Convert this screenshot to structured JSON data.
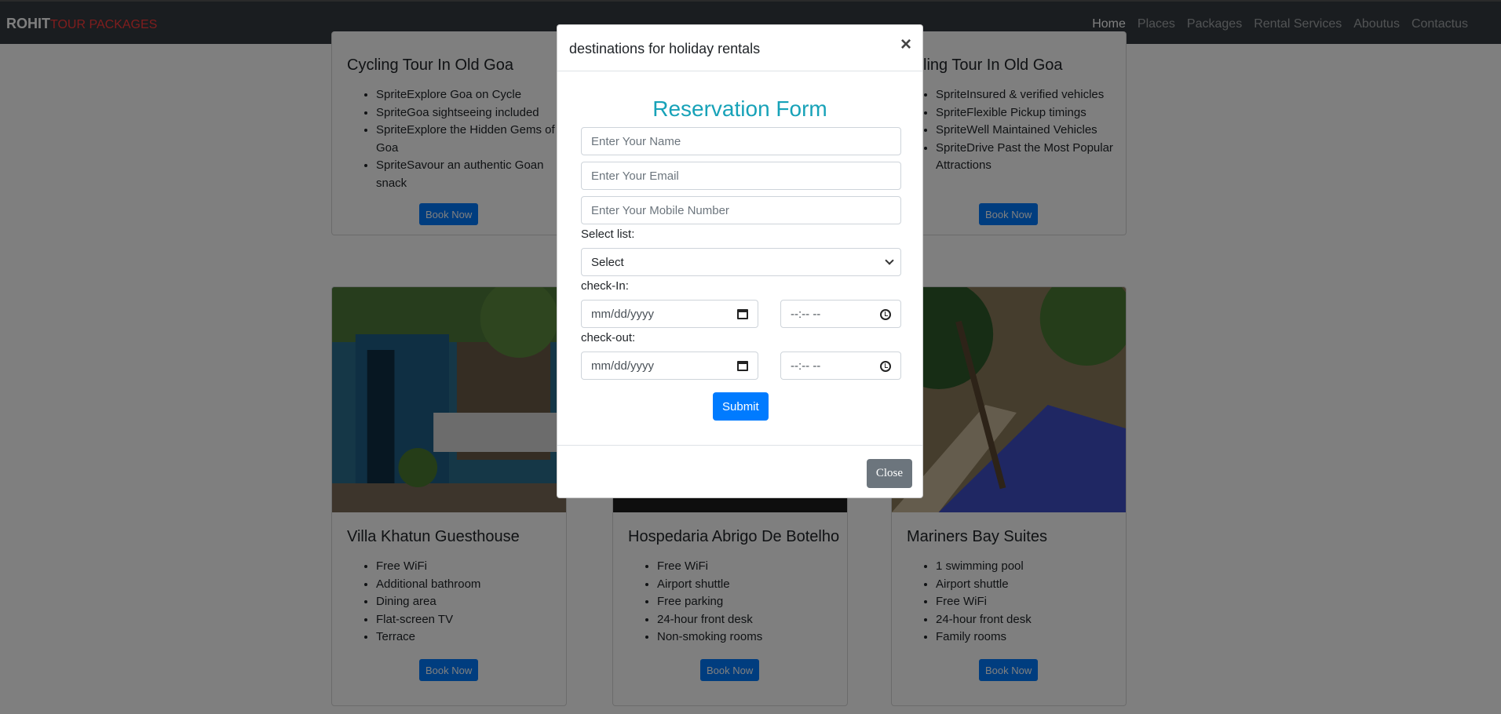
{
  "navbar": {
    "brand_main": "ROHIT",
    "brand_sub": "TOUR PACKAGES",
    "links": [
      "Home",
      "Places",
      "Packages",
      "Rental Services",
      "Aboutus",
      "Contactus"
    ]
  },
  "top_cards": [
    {
      "title": "Cycling Tour In Old Goa",
      "features": [
        "SpriteExplore Goa on Cycle",
        "SpriteGoa sightseeing included",
        "SpriteExplore the Hidden Gems of Goa",
        "SpriteSavour an authentic Goan snack"
      ],
      "button": "Book Now"
    },
    {
      "title": "cling Tour In Old Goa",
      "features": [
        "SpriteInsured & verified vehicles",
        "SpriteFlexible Pickup timings",
        "SpriteWell Maintained Vehicles",
        "SpriteDrive Past the Most Popular Attractions"
      ],
      "button": "Book Now"
    }
  ],
  "bottom_cards": [
    {
      "title": "Villa Khatun Guesthouse",
      "features": [
        "Free WiFi",
        "Additional bathroom",
        "Dining area",
        "Flat-screen TV",
        "Terrace"
      ],
      "button": "Book Now"
    },
    {
      "title": "Hospedaria Abrigo De Botelho",
      "features": [
        "Free WiFi",
        "Airport shuttle",
        "Free parking",
        "24-hour front desk",
        "Non-smoking rooms"
      ],
      "button": "Book Now"
    },
    {
      "title": "Mariners Bay Suites",
      "features": [
        "1 swimming pool",
        "Airport shuttle",
        "Free WiFi",
        "24-hour front desk",
        "Family rooms"
      ],
      "button": "Book Now"
    }
  ],
  "modal": {
    "title": "destinations for holiday rentals",
    "close_x": "×",
    "heading": "Reservation Form",
    "name_placeholder": "Enter Your Name",
    "email_placeholder": "Enter Your Email",
    "mobile_placeholder": "Enter Your Mobile Number",
    "select_label": "Select list:",
    "select_value": "Select",
    "checkin_label": "check-In:",
    "checkout_label": "check-out:",
    "date_placeholder": "mm/dd/yyyy",
    "time_placeholder": "--:-- --",
    "submit": "Submit",
    "close": "Close"
  },
  "colors": {
    "navbar_bg": "#343a40",
    "brand_accent": "#ff3b3b",
    "primary": "#007bff",
    "heading": "#17a2b8",
    "secondary": "#6c757d"
  }
}
